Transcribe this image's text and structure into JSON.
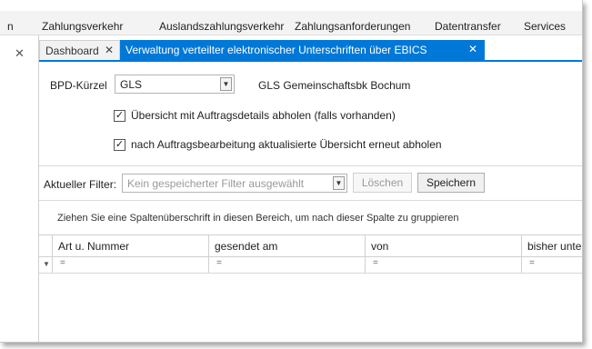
{
  "menubar": {
    "items": [
      "n",
      "Zahlungsverkehr",
      "Auslandszahlungsverkehr",
      "Zahlungsanforderungen",
      "Datentransfer",
      "Services"
    ]
  },
  "left_pane": {
    "close_glyph": "✕"
  },
  "tabs": [
    {
      "label": "Dashboard",
      "close": "✕",
      "active": false
    },
    {
      "label": "Verwaltung verteilter elektronischer Unterschriften über EBICS",
      "close": "✕",
      "active": true
    }
  ],
  "form": {
    "bpd_label": "BPD-Kürzel",
    "bpd_value": "GLS",
    "bank_name": "GLS Gemeinschaftsbk Bochum",
    "checkbox1": {
      "label": "Übersicht mit Auftragsdetails abholen (falls vorhanden)",
      "checked": true,
      "mark": "✓"
    },
    "checkbox2": {
      "label": "nach Auftragsbearbeitung aktualisierte Übersicht erneut abholen",
      "checked": true,
      "mark": "✓"
    }
  },
  "filter_bar": {
    "label": "Aktueller Filter:",
    "placeholder": "Kein gespeicherter Filter ausgewählt",
    "delete_button": "Löschen",
    "save_button": "Speichern"
  },
  "grid": {
    "group_hint": "Ziehen Sie eine Spaltenüberschrift in diesen Bereich, um nach dieser Spalte zu gruppieren",
    "columns": [
      "Art u. Nummer",
      "gesendet am",
      "von",
      "bisher unte"
    ],
    "filter_operator": "=",
    "filter_icon": "funnel-icon"
  },
  "colors": {
    "accent": "#0078d7",
    "menubar_bg": "#f3f3f3"
  }
}
